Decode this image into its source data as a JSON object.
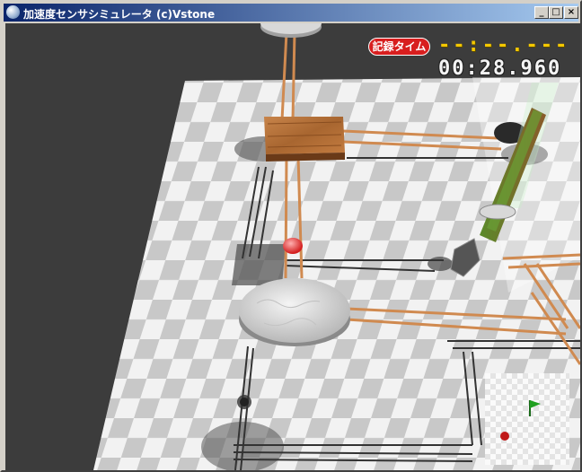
{
  "window": {
    "title": "加速度センサシミュレータ (c)Vstone",
    "minimize_glyph": "_",
    "maximize_glyph": "□",
    "close_glyph": "×"
  },
  "hud": {
    "record_label": "記録タイム",
    "record_time": "--:--.---",
    "elapsed_time": "00:28.960"
  },
  "colors": {
    "title_bar": "#0a246a",
    "record_badge": "#d81e1e",
    "record_digits": "#f5c800",
    "timer_digits": "#f4f4f4",
    "floor_light": "#f2f2f2",
    "floor_dark": "#c4c4c4",
    "rail": "#d08a50",
    "wood_block": "#b0703a",
    "ball": "#e83a3a",
    "goal_flag": "#20a020"
  },
  "scene": {
    "minimap_icons": [
      "goal-flag-icon",
      "ball-marker-icon"
    ]
  }
}
